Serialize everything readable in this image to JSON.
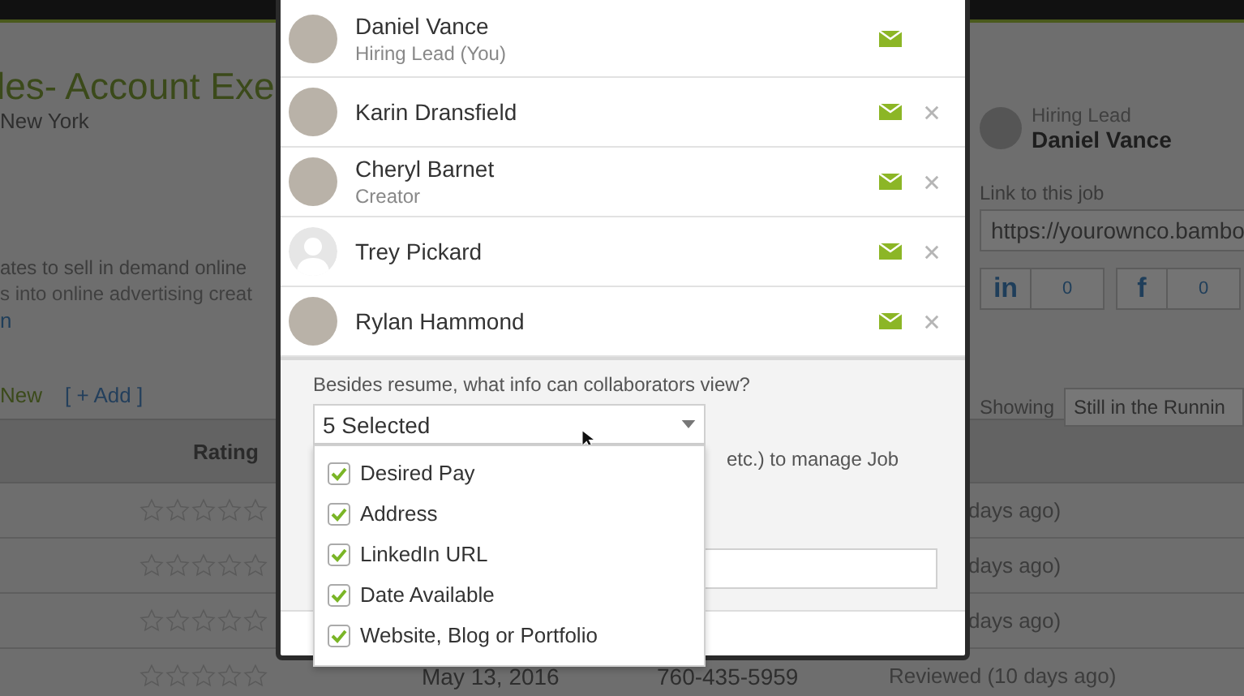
{
  "job": {
    "title": "les- Account Exe",
    "location": "New York",
    "description": [
      "ates to sell in demand online",
      "s into online advertising creat"
    ],
    "link": "n",
    "tab": "New",
    "add_link": "[ + Add ]"
  },
  "sidebar": {
    "hiring_lead_label": "Hiring Lead",
    "hiring_lead_name": "Daniel Vance",
    "link_label": "Link to this job",
    "link_value": "https://yourownco.bambo",
    "shares": [
      {
        "icon": "in",
        "count": "0"
      },
      {
        "icon": "f",
        "count": "0"
      }
    ],
    "showing_label": "Showing",
    "showing_value": "Still in the Runnin"
  },
  "table": {
    "columns": [
      "Rating"
    ],
    "rows": [
      {
        "stars": 0,
        "status": "days ago)"
      },
      {
        "stars": 0,
        "status": "days ago)"
      },
      {
        "stars": 0,
        "status": "days ago)"
      },
      {
        "stars": 0,
        "date": "May 13, 2016",
        "phone": "760-435-5959",
        "status": "Reviewed (10 days ago)"
      }
    ]
  },
  "modal": {
    "collaborators": [
      {
        "name": "Daniel Vance",
        "role": "Hiring Lead (You)",
        "kind": "photo",
        "removable": false
      },
      {
        "name": "Karin Dransfield",
        "kind": "photo",
        "removable": true
      },
      {
        "name": "Cheryl Barnet",
        "role": "Creator",
        "kind": "photo",
        "removable": true
      },
      {
        "name": "Trey Pickard",
        "kind": "silhouette",
        "removable": true
      },
      {
        "name": "Rylan Hammond",
        "kind": "photo",
        "removable": true
      }
    ],
    "question": "Besides resume, what info can collaborators view?",
    "dropdown": {
      "value": "5 Selected",
      "options": [
        {
          "label": "Desired Pay",
          "checked": true
        },
        {
          "label": "Address",
          "checked": true
        },
        {
          "label": "LinkedIn URL",
          "checked": true
        },
        {
          "label": "Date Available",
          "checked": true
        },
        {
          "label": "Website, Blog or Portfolio",
          "checked": true
        }
      ]
    },
    "permission_text": "etc.) to manage Job"
  }
}
